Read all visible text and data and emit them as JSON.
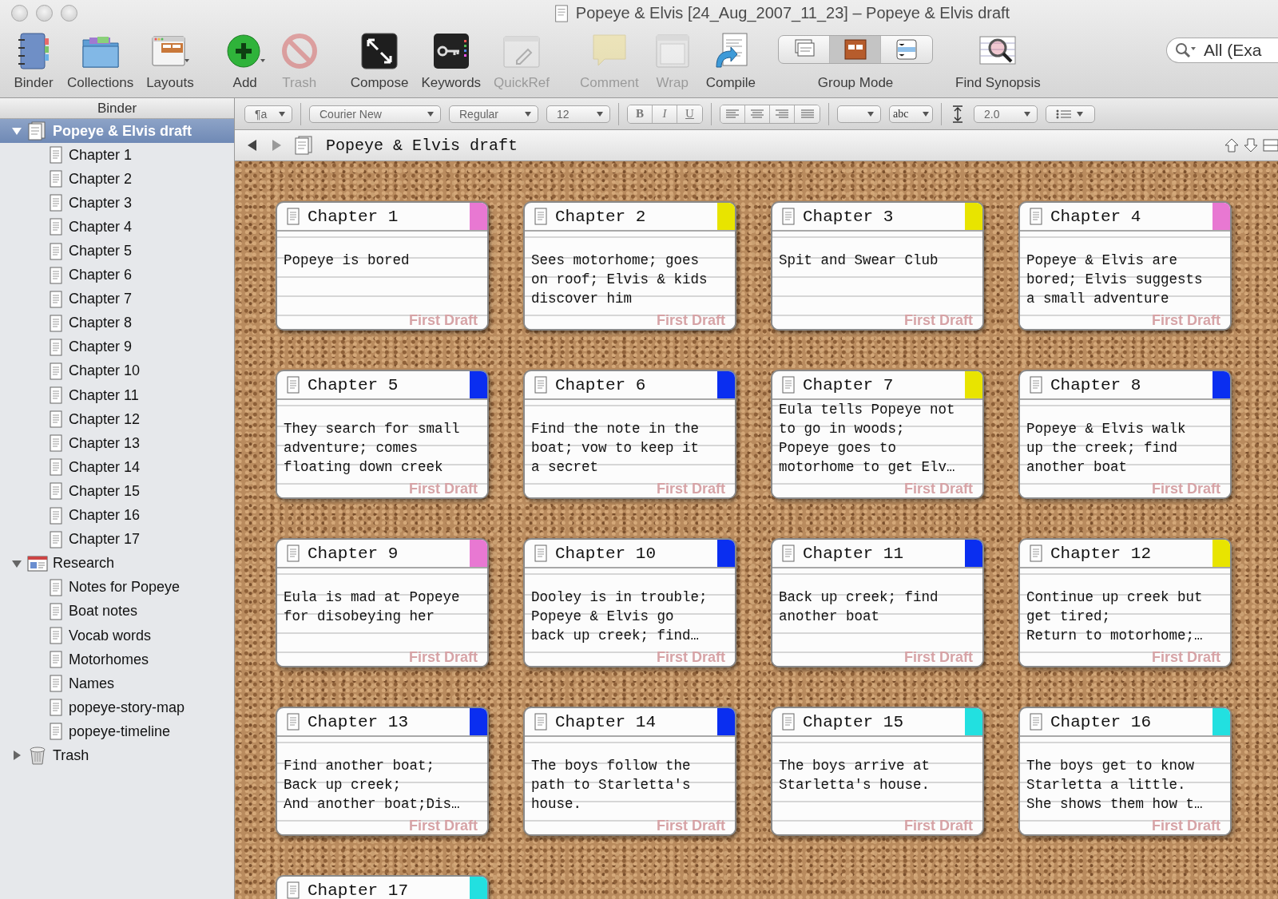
{
  "window": {
    "title": "Popeye & Elvis [24_Aug_2007_11_23] – Popeye & Elvis draft"
  },
  "toolbar": [
    {
      "kind": "binder",
      "label": "Binder",
      "disabled": false
    },
    {
      "kind": "collections",
      "label": "Collections",
      "disabled": false
    },
    {
      "kind": "layouts",
      "label": "Layouts",
      "disabled": false
    },
    {
      "kind": "add",
      "label": "Add",
      "disabled": false
    },
    {
      "kind": "trash",
      "label": "Trash",
      "disabled": true
    },
    {
      "kind": "compose",
      "label": "Compose",
      "disabled": false
    },
    {
      "kind": "keywords",
      "label": "Keywords",
      "disabled": false
    },
    {
      "kind": "quickref",
      "label": "QuickRef",
      "disabled": true
    },
    {
      "kind": "comment",
      "label": "Comment",
      "disabled": true
    },
    {
      "kind": "wrap",
      "label": "Wrap",
      "disabled": true
    },
    {
      "kind": "compile",
      "label": "Compile",
      "disabled": false
    },
    {
      "kind": "groupmode",
      "label": "Group Mode",
      "segments": [
        {
          "selected": false
        },
        {
          "selected": true
        },
        {
          "selected": false
        }
      ]
    },
    {
      "kind": "findsynopsis",
      "label": "Find Synopsis",
      "disabled": false
    }
  ],
  "search": {
    "value": "All (Exa"
  },
  "binder": {
    "header": "Binder",
    "items": [
      {
        "kind": "draft",
        "label": "Popeye & Elvis draft",
        "selected": true,
        "expanded": true,
        "children": [
          {
            "kind": "doc",
            "label": "Chapter 1",
            "selected": false
          },
          {
            "kind": "doc",
            "label": "Chapter 2",
            "selected": false
          },
          {
            "kind": "doc",
            "label": "Chapter 3",
            "selected": false
          },
          {
            "kind": "doc",
            "label": "Chapter 4",
            "selected": false
          },
          {
            "kind": "doc",
            "label": "Chapter 5",
            "selected": false
          },
          {
            "kind": "doc",
            "label": "Chapter 6",
            "selected": false
          },
          {
            "kind": "doc",
            "label": "Chapter 7",
            "selected": false
          },
          {
            "kind": "doc",
            "label": "Chapter 8",
            "selected": false
          },
          {
            "kind": "doc",
            "label": "Chapter 9",
            "selected": false
          },
          {
            "kind": "doc",
            "label": "Chapter 10",
            "selected": false
          },
          {
            "kind": "doc",
            "label": "Chapter 11",
            "selected": false
          },
          {
            "kind": "doc",
            "label": "Chapter 12",
            "selected": false
          },
          {
            "kind": "doc",
            "label": "Chapter 13",
            "selected": false
          },
          {
            "kind": "doc",
            "label": "Chapter 14",
            "selected": false
          },
          {
            "kind": "doc",
            "label": "Chapter 15",
            "selected": false
          },
          {
            "kind": "doc",
            "label": "Chapter 16",
            "selected": false
          },
          {
            "kind": "doc",
            "label": "Chapter 17",
            "selected": false
          }
        ]
      },
      {
        "kind": "research",
        "label": "Research",
        "selected": false,
        "expanded": true,
        "children": [
          {
            "kind": "doc",
            "label": "Notes for Popeye",
            "selected": false
          },
          {
            "kind": "doc",
            "label": "Boat notes",
            "selected": false
          },
          {
            "kind": "doc",
            "label": "Vocab words",
            "selected": false
          },
          {
            "kind": "doc",
            "label": "Motorhomes",
            "selected": false
          },
          {
            "kind": "doc",
            "label": "Names",
            "selected": false
          },
          {
            "kind": "doc",
            "label": "popeye-story-map",
            "selected": false
          },
          {
            "kind": "doc",
            "label": "popeye-timeline",
            "selected": false
          }
        ]
      },
      {
        "kind": "trash",
        "label": "Trash",
        "selected": false,
        "expanded": false
      }
    ]
  },
  "format_bar": {
    "paragraph_style": "¶a",
    "font": "Courier New",
    "typeface": "Regular",
    "size": "12",
    "bold": "B",
    "italic": "I",
    "underline": "U",
    "highlight": "abc",
    "line_spacing": "2.0"
  },
  "header_bar": {
    "title": "Popeye & Elvis draft"
  },
  "corkboard": {
    "cards": [
      {
        "title": "Chapter 1",
        "color": "#e878d2",
        "stamp": "First Draft",
        "lines": [
          "Popeye is bored"
        ]
      },
      {
        "title": "Chapter 2",
        "color": "#e8e400",
        "stamp": "First Draft",
        "lines": [
          "Sees motorhome; goes",
          "on roof; Elvis & kids",
          "discover him"
        ]
      },
      {
        "title": "Chapter 3",
        "color": "#e8e400",
        "stamp": "First Draft",
        "lines": [
          "Spit and Swear Club"
        ]
      },
      {
        "title": "Chapter 4",
        "color": "#e878d2",
        "stamp": "First Draft",
        "lines": [
          "Popeye & Elvis are",
          "bored; Elvis suggests",
          "a small adventure"
        ]
      },
      {
        "title": "Chapter 5",
        "color": "#0a2ef0",
        "stamp": "First Draft",
        "lines": [
          "They search for small",
          "adventure; comes",
          "floating down creek"
        ]
      },
      {
        "title": "Chapter 6",
        "color": "#0a2ef0",
        "stamp": "First Draft",
        "lines": [
          "Find the note in the",
          "boat; vow to keep it",
          "a secret"
        ]
      },
      {
        "title": "Chapter 7",
        "color": "#e8e400",
        "stamp": "First Draft",
        "lines": [
          "Eula tells Popeye not",
          "to go in woods;",
          "Popeye goes to",
          "motorhome to get Elv…"
        ]
      },
      {
        "title": "Chapter 8",
        "color": "#0a2ef0",
        "stamp": "First Draft",
        "lines": [
          "Popeye & Elvis walk",
          "up the creek; find",
          "another boat"
        ]
      },
      {
        "title": "Chapter 9",
        "color": "#e878d2",
        "stamp": "First Draft",
        "lines": [
          "Eula is mad at Popeye",
          "for disobeying her"
        ]
      },
      {
        "title": "Chapter 10",
        "color": "#0a2ef0",
        "stamp": "First Draft",
        "lines": [
          "Dooley is in trouble;",
          "Popeye & Elvis go",
          "back up creek; find…"
        ]
      },
      {
        "title": "Chapter 11",
        "color": "#0a2ef0",
        "stamp": "First Draft",
        "lines": [
          "Back up creek; find",
          "another boat"
        ]
      },
      {
        "title": "Chapter 12",
        "color": "#e8e400",
        "stamp": "First Draft",
        "lines": [
          "Continue up creek but",
          "get tired;",
          "Return to motorhome;…"
        ]
      },
      {
        "title": "Chapter 13",
        "color": "#0a2ef0",
        "stamp": "First Draft",
        "lines": [
          "Find another boat;",
          "Back up creek;",
          "And another boat;Dis…"
        ]
      },
      {
        "title": "Chapter 14",
        "color": "#0a2ef0",
        "stamp": "First Draft",
        "lines": [
          "The boys follow the",
          "path to Starletta's",
          "house."
        ]
      },
      {
        "title": "Chapter 15",
        "color": "#22e0e0",
        "stamp": "First Draft",
        "lines": [
          "The boys arrive at",
          "Starletta's house."
        ]
      },
      {
        "title": "Chapter 16",
        "color": "#22e0e0",
        "stamp": "First Draft",
        "lines": [
          "The boys get to know",
          "Starletta a little.",
          "She shows them how t…"
        ]
      },
      {
        "title": "Chapter 17",
        "color": "#22e0e0"
      }
    ]
  }
}
